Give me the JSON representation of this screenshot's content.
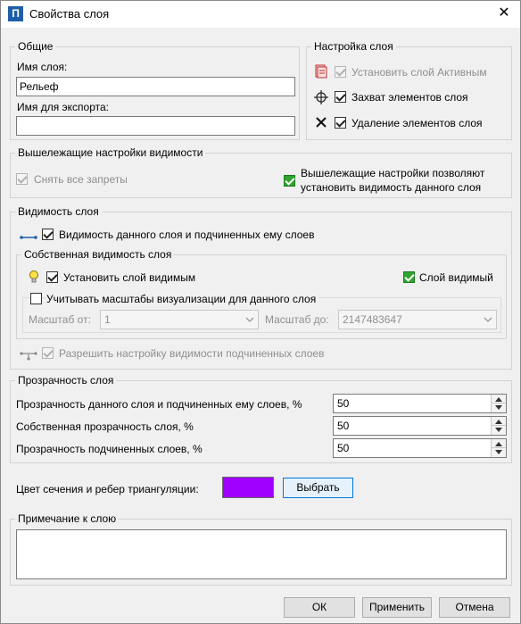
{
  "window": {
    "title": "Свойства слоя",
    "app_icon_letter": "П",
    "close_glyph": "✕"
  },
  "general": {
    "legend": "Общие",
    "layer_name_label": "Имя слоя:",
    "layer_name_value": "Рельеф",
    "export_name_label": "Имя для экспорта:",
    "export_name_value": ""
  },
  "layer_settings": {
    "legend": "Настройка слоя",
    "set_active_label": "Установить слой Активным",
    "capture_label": "Захват элементов слоя",
    "delete_label": "Удаление элементов слоя"
  },
  "parent_visibility": {
    "legend": "Вышележащие настройки видимости",
    "remove_all_label": "Снять все запреты",
    "allow_line1": "Вышележащие настройки позволяют",
    "allow_line2": "установить видимость данного слоя"
  },
  "layer_visibility": {
    "legend": "Видимость слоя",
    "visibility_label": "Видимость данного слоя и подчиненных ему слоев",
    "own_legend": "Собственная видимость слоя",
    "set_visible_label": "Установить слой видимым",
    "layer_visible_label": "Слой видимый",
    "scale_legend": "Учитывать масштабы визуализации для данного слоя",
    "scale_from_label": "Масштаб от:",
    "scale_from_value": "1",
    "scale_to_label": "Масштаб до:",
    "scale_to_value": "2147483647",
    "allow_sub_label": "Разрешить настройку видимости подчиненных слоев"
  },
  "transparency": {
    "legend": "Прозрачность слоя",
    "rows": [
      {
        "label": "Прозрачность данного слоя и подчиненных ему слоев, %",
        "value": "50"
      },
      {
        "label": "Собственная прозрачность слоя, %",
        "value": "50"
      },
      {
        "label": "Прозрачность подчиненных слоев, %",
        "value": "50"
      }
    ]
  },
  "color": {
    "label": "Цвет сечения и ребер триангуляции:",
    "swatch_color": "#a000ff",
    "choose_button": "Выбрать"
  },
  "note": {
    "legend": "Примечание к слою",
    "value": ""
  },
  "buttons": {
    "ok": "ОК",
    "apply": "Применить",
    "cancel": "Отмена"
  },
  "icons": {
    "set_active": "layer-stack-icon",
    "capture": "crosshair-icon",
    "delete": "x-cross-icon",
    "visibility": "line-node-icon",
    "set_visible": "lightbulb-icon",
    "allow_sub": "tree-branch-icon"
  }
}
